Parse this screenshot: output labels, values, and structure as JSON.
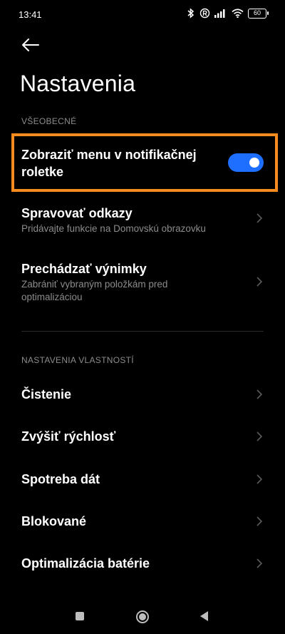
{
  "status_bar": {
    "time": "13:41",
    "battery": "60",
    "icons": [
      "bluetooth-icon",
      "registered-icon",
      "signal-icon",
      "wifi-icon",
      "battery-icon"
    ]
  },
  "header": {
    "back_icon": "arrow-left-icon",
    "title": "Nastavenia"
  },
  "general": {
    "section_label": "VŠEOBECNÉ",
    "toggle_item": {
      "title_line1": "Zobraziť menu v notifikačnej",
      "title_line2": "roletke",
      "enabled": true,
      "highlight_color": "#f68b1f",
      "toggle_color": "#1e6fff"
    },
    "items": [
      {
        "title": "Spravovať odkazy",
        "subtitle": "Pridávajte funkcie na Domovskú obrazovku"
      },
      {
        "title": "Prechádzať výnimky",
        "subtitle_line1": "Zabrániť vybraným položkám pred",
        "subtitle_line2": "optimalizáciou"
      }
    ]
  },
  "properties": {
    "section_label": "NASTAVENIA VLASTNOSTÍ",
    "items": [
      {
        "title": "Čistenie"
      },
      {
        "title": "Zvýšiť rýchlosť"
      },
      {
        "title": "Spotreba dát"
      },
      {
        "title": "Blokované"
      },
      {
        "title": "Optimalizácia batérie"
      }
    ]
  },
  "nav_bar": {
    "icons": [
      "recents-square-icon",
      "home-circle-icon",
      "back-triangle-icon"
    ]
  }
}
